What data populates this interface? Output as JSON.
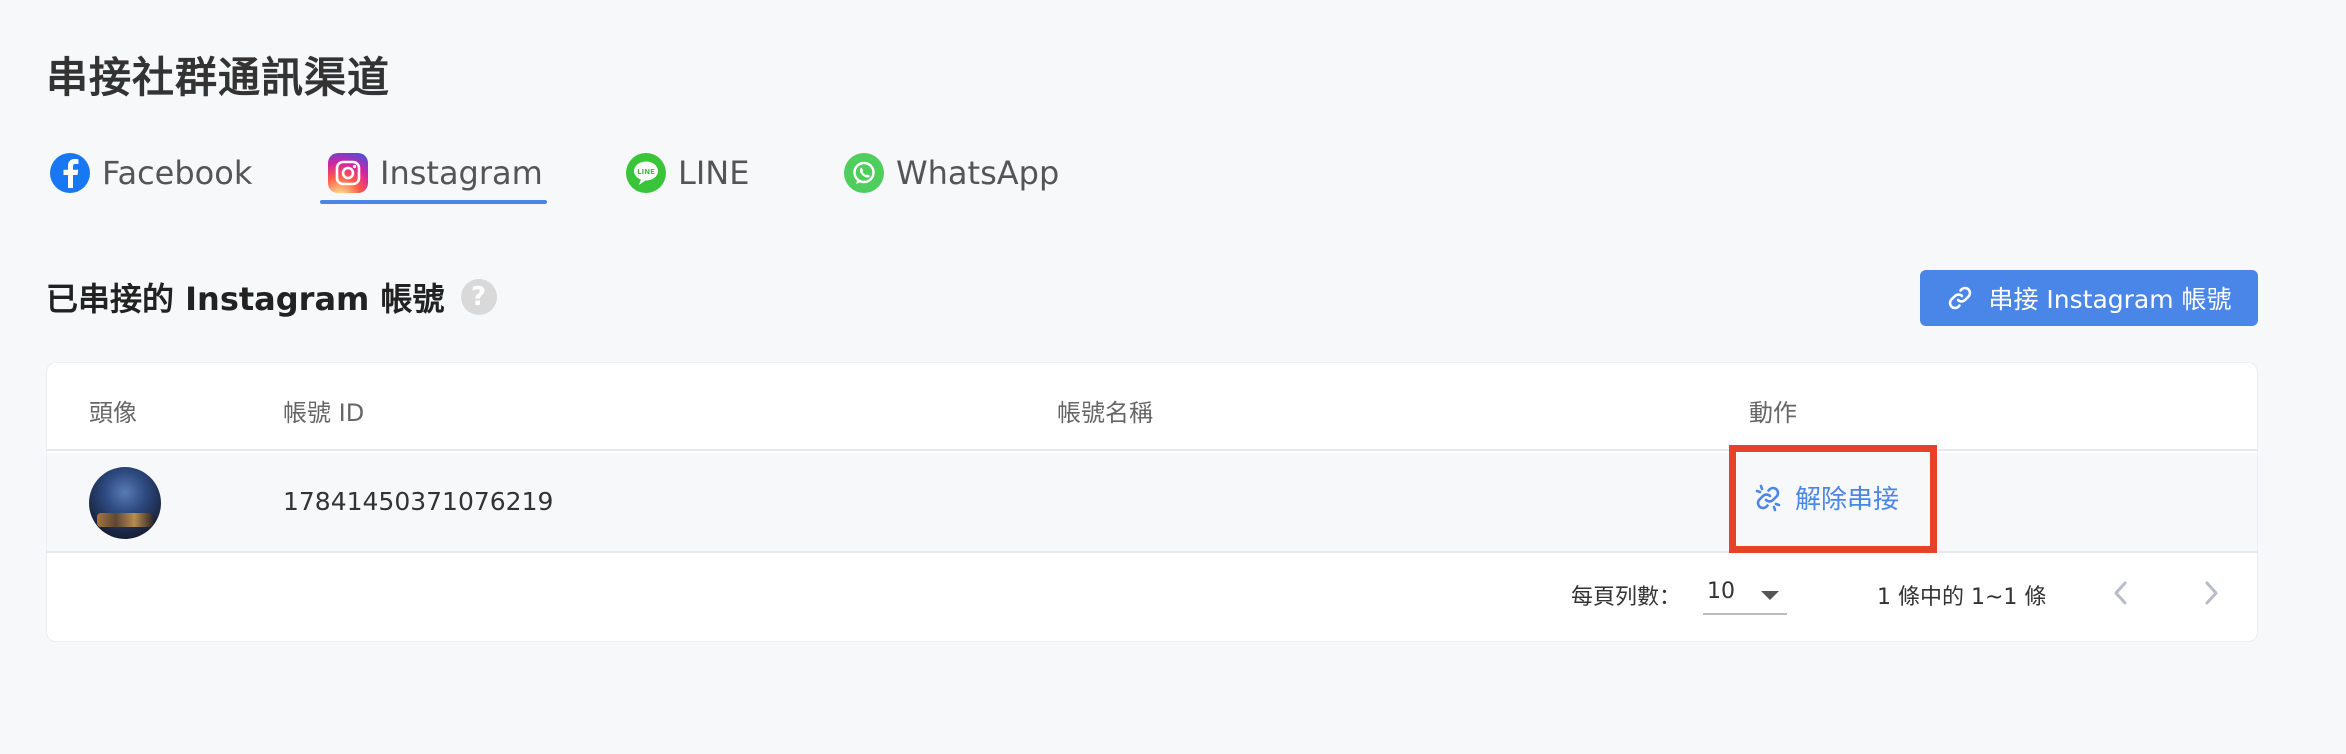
{
  "page": {
    "title": "串接社群通訊渠道"
  },
  "tabs": [
    {
      "label": "Facebook",
      "icon": "facebook-icon",
      "active": false
    },
    {
      "label": "Instagram",
      "icon": "instagram-icon",
      "active": true
    },
    {
      "label": "LINE",
      "icon": "line-icon",
      "active": false
    },
    {
      "label": "WhatsApp",
      "icon": "whatsapp-icon",
      "active": false
    }
  ],
  "section": {
    "title": "已串接的 Instagram 帳號",
    "help_icon": "question-icon",
    "connect_button_label": "串接 Instagram 帳號"
  },
  "table": {
    "headers": [
      "頭像",
      "帳號 ID",
      "帳號名稱",
      "動作"
    ],
    "rows": [
      {
        "account_id": "17841450371076219",
        "account_name": "",
        "action_label": "解除串接"
      }
    ]
  },
  "pagination": {
    "per_page_label": "每頁列數：",
    "per_page_value": "10",
    "range_text": "1 條中的 1~1 條"
  },
  "colors": {
    "accent": "#4a86e8",
    "highlight": "#e8402a",
    "background": "#f7f8fa"
  }
}
